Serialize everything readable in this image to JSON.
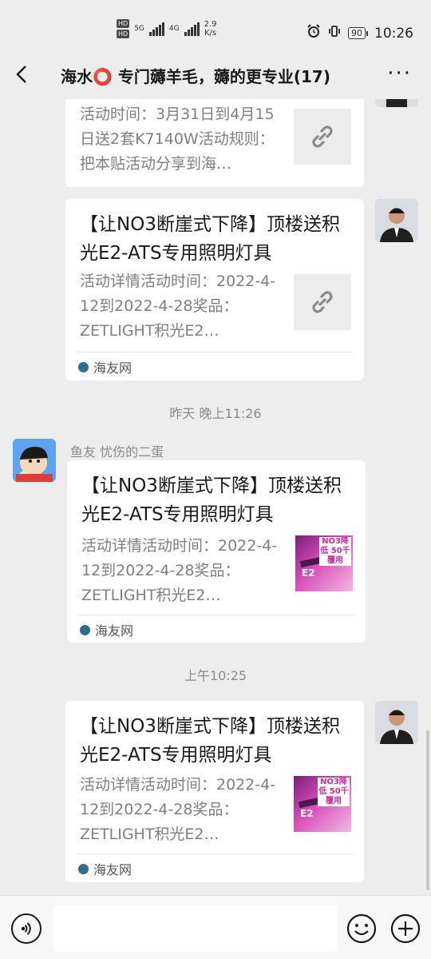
{
  "status_bar": {
    "hd1": "HD",
    "hd2": "HD",
    "network_a": "5G",
    "network_b": "4G",
    "speed_value": "2.9",
    "speed_unit": "K/s",
    "battery": "90",
    "time": "10:26"
  },
  "header": {
    "title": "海水⭕ 专门薅羊毛，薅的更专业(17)"
  },
  "messages": [
    {
      "desc": "活动时间：3月31日到4月15日送2套K7140W活动规则：把本贴活动分享到海…"
    },
    {
      "title": "【让NO3断崖式下降】顶楼送积光E2-ATS专用照明灯具",
      "desc": "活动详情活动时间：2022-4-12到2022-4-28奖品：ZETLIGHT积光E2…",
      "source": "海友网"
    },
    {
      "timestamp": "昨天 晚上11:26",
      "sender": "鱼友 忧伤的二蛋",
      "title": "【让NO3断崖式下降】顶楼送积光E2-ATS专用照明灯具",
      "desc": "活动详情活动时间：2022-4-12到2022-4-28奖品：ZETLIGHT积光E2…",
      "source": "海友网"
    },
    {
      "timestamp": "上午10:25",
      "title": "【让NO3断崖式下降】顶楼送积光E2-ATS专用照明灯具",
      "desc": "活动详情活动时间：2022-4-12到2022-4-28奖品：ZETLIGHT积光E2…",
      "source": "海友网"
    }
  ],
  "promo": {
    "badge": "NO3降低 50千覆用",
    "model": "E2"
  },
  "input": {
    "value": ""
  }
}
